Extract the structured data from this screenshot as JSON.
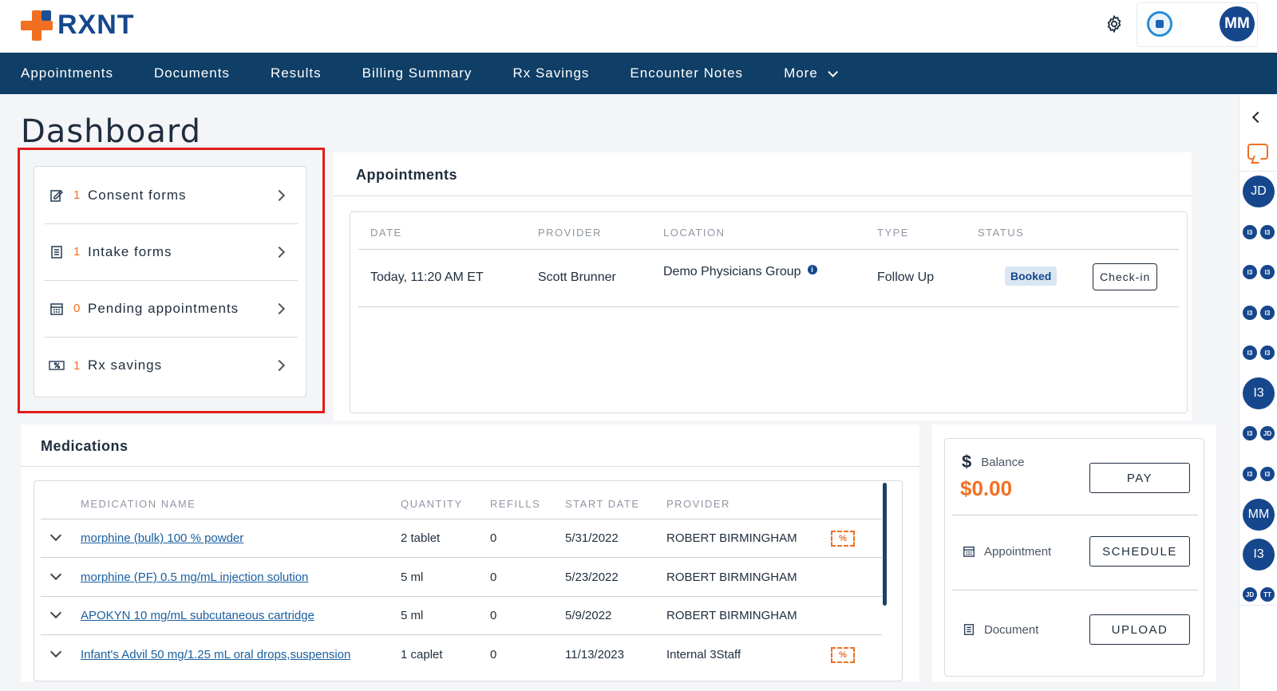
{
  "header": {
    "logo_text": "RXNT",
    "avatar_initials": "MM",
    "icons": [
      "gear-icon",
      "partner-logo"
    ]
  },
  "nav": {
    "items": [
      "Appointments",
      "Documents",
      "Results",
      "Billing Summary",
      "Rx Savings",
      "Encounter Notes",
      "More"
    ]
  },
  "page_title": "Dashboard",
  "forms": [
    {
      "count": "1",
      "label": "Consent forms",
      "icon": "consent-form-icon"
    },
    {
      "count": "1",
      "label": "Intake forms",
      "icon": "intake-form-icon"
    },
    {
      "count": "0",
      "label": "Pending appointments",
      "icon": "calendar-icon"
    },
    {
      "count": "1",
      "label": "Rx savings",
      "icon": "rx-savings-icon"
    }
  ],
  "appointments": {
    "title": "Appointments",
    "headers": [
      "DATE",
      "PROVIDER",
      "LOCATION",
      "TYPE",
      "STATUS"
    ],
    "rows": [
      {
        "date": "Today, 11:20 AM ET",
        "provider": "Scott Brunner",
        "location": "Demo Physicians Group",
        "type": "Follow Up",
        "status": "Booked",
        "action": "Check-in"
      }
    ]
  },
  "medications": {
    "title": "Medications",
    "headers": [
      "MEDICATION NAME",
      "QUANTITY",
      "REFILLS",
      "START DATE",
      "PROVIDER"
    ],
    "rows": [
      {
        "name": "morphine (bulk) 100 % powder",
        "quantity": "2 tablet",
        "refills": "0",
        "start_date": "5/31/2022",
        "provider": "ROBERT BIRMINGHAM",
        "rx_savings": true
      },
      {
        "name": "morphine (PF) 0.5 mg/mL injection solution",
        "quantity": "5 ml",
        "refills": "0",
        "start_date": "5/23/2022",
        "provider": "ROBERT BIRMINGHAM",
        "rx_savings": false
      },
      {
        "name": "APOKYN 10 mg/mL subcutaneous cartridge",
        "quantity": "5 ml",
        "refills": "0",
        "start_date": "5/9/2022",
        "provider": "ROBERT BIRMINGHAM",
        "rx_savings": false
      },
      {
        "name": "Infant's Advil 50 mg/1.25 mL oral drops,suspension",
        "quantity": "1 caplet",
        "refills": "0",
        "start_date": "11/13/2023",
        "provider": "Internal 3Staff",
        "rx_savings": true
      }
    ],
    "rx_tag_text": "%"
  },
  "balance": {
    "label": "Balance",
    "amount": "$0.00",
    "pay_label": "PAY",
    "appointment_label": "Appointment",
    "schedule_label": "SCHEDULE",
    "document_label": "Document",
    "upload_label": "UPLOAD"
  },
  "rail": {
    "items": [
      "JD",
      "I3",
      "MM",
      "I3"
    ],
    "small_pairs": [
      [
        "I3",
        "I3"
      ],
      [
        "I3",
        "I3"
      ],
      [
        "I3",
        "I3"
      ],
      [
        "I3",
        "I3"
      ],
      [
        "I3",
        "JD"
      ],
      [
        "I3",
        "I3"
      ],
      [
        "JD",
        "TT"
      ]
    ]
  },
  "colors": {
    "brand_navy": "#0f3e66",
    "accent_orange": "#f26f21",
    "link_blue": "#1a5fa0",
    "highlight_red": "#e21d1d"
  }
}
